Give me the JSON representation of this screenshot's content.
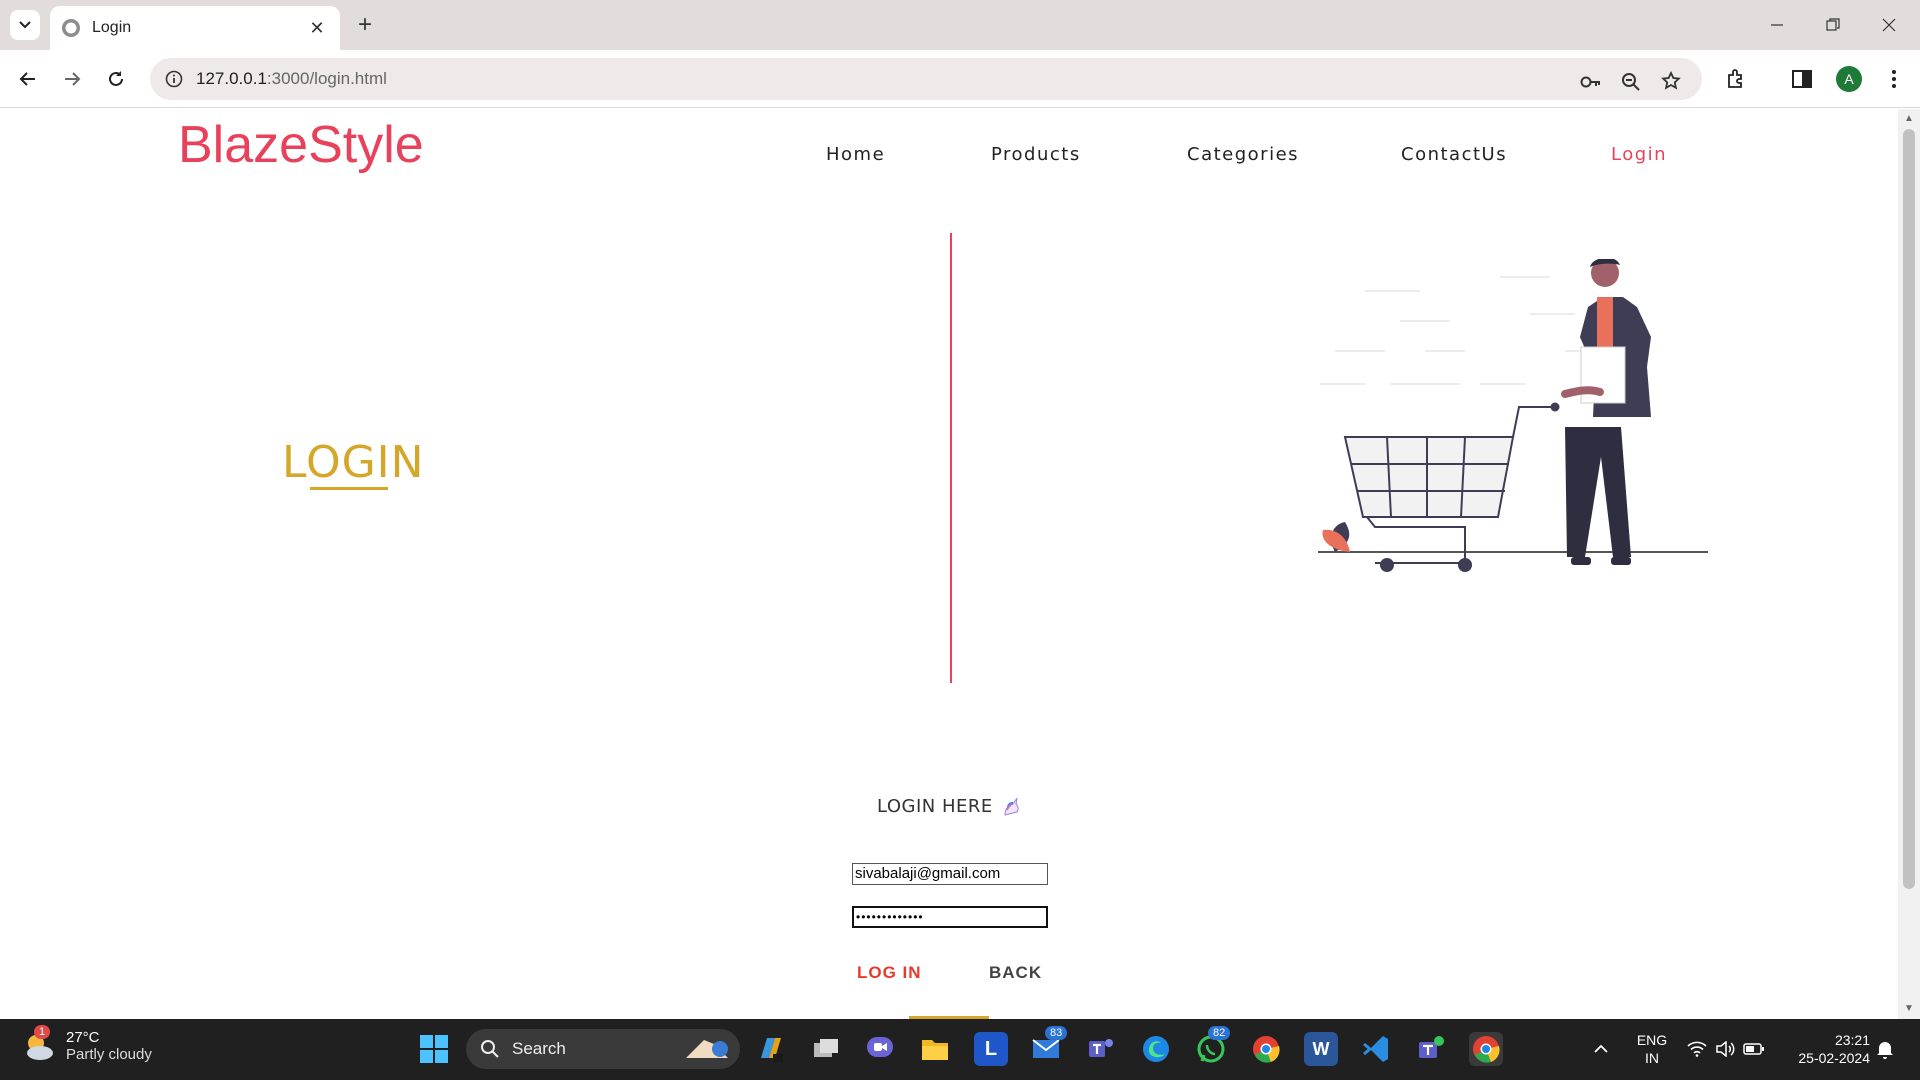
{
  "browser": {
    "tab_title": "Login",
    "url_host": "127.0.0.1",
    "url_rest": ":3000/login.html",
    "profile_initial": "A"
  },
  "header": {
    "brand": "BlazeStyle",
    "nav": [
      {
        "label": "Home"
      },
      {
        "label": "Products"
      },
      {
        "label": "Categories"
      },
      {
        "label": "ContactUs"
      },
      {
        "label": "Login",
        "active": true
      }
    ]
  },
  "hero": {
    "heading": "LOGIN"
  },
  "form": {
    "title": "LOGIN HERE",
    "email_value": "sivabalaji@gmail.com",
    "password_mask": "•••••••••••••",
    "login_label": "LOG IN",
    "back_label": "BACK"
  },
  "taskbar": {
    "weather_temp": "27°C",
    "weather_cond": "Partly cloudy",
    "weather_badge": "1",
    "search_label": "Search",
    "mail_badge": "83",
    "whatsapp_badge": "82",
    "lang_top": "ENG",
    "lang_bottom": "IN",
    "time": "23:21",
    "date": "25-02-2024"
  },
  "colors": {
    "accent": "#e8415c",
    "gold": "#d4a62a"
  }
}
